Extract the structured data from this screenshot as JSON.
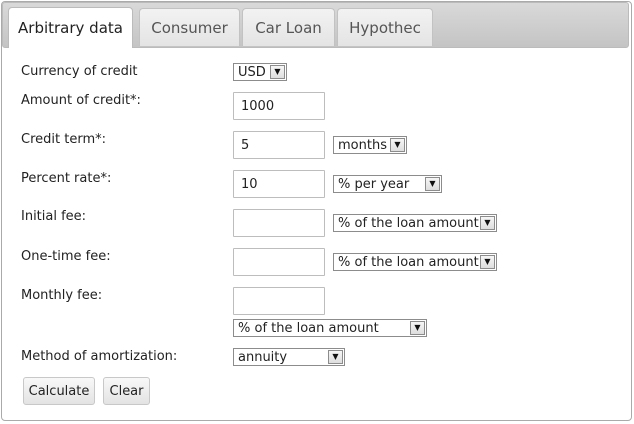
{
  "tabs": [
    {
      "label": "Arbitrary data",
      "active": true
    },
    {
      "label": "Consumer",
      "active": false
    },
    {
      "label": "Car Loan",
      "active": false
    },
    {
      "label": "Hypothec",
      "active": false
    }
  ],
  "form": {
    "currency": {
      "label": "Currency of credit",
      "selected": "USD"
    },
    "amount": {
      "label": "Amount of credit*:",
      "value": "1000"
    },
    "term": {
      "label": "Credit term*:",
      "value": "5",
      "unit": "months"
    },
    "rate": {
      "label": "Percent rate*:",
      "value": "10",
      "unit": "% per year"
    },
    "initial_fee": {
      "label": "Initial fee:",
      "value": "",
      "unit": "% of the loan amount"
    },
    "one_time_fee": {
      "label": "One-time fee:",
      "value": "",
      "unit": "% of the loan amount"
    },
    "monthly_fee": {
      "label": "Monthly fee:",
      "value": "",
      "unit": "% of the loan amount"
    },
    "amortization": {
      "label": "Method of amortization:",
      "selected": "annuity"
    }
  },
  "buttons": {
    "calculate": "Calculate",
    "clear": "Clear"
  },
  "icons": {
    "dropdown_arrow": "triangle-down-icon"
  }
}
